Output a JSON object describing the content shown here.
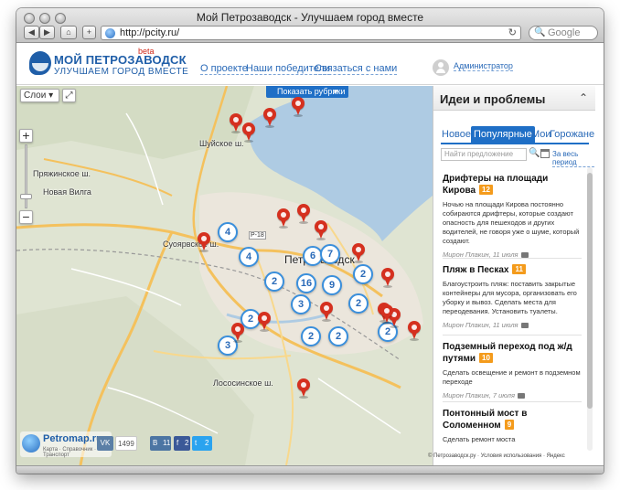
{
  "browser": {
    "window_title": "Мой Петрозаводск - Улучшаем город вместе",
    "url": "http://pcity.ru/",
    "search_placeholder": "Google"
  },
  "site": {
    "logo_title": "МОЙ ПЕТРОЗАВОДСК",
    "logo_beta": "beta",
    "logo_subtitle": "УЛУЧШАЕМ ГОРОД ВМЕСТЕ",
    "nav": [
      "О проекте",
      "Наши победители",
      "Связаться с нами"
    ],
    "user_link": "Администратор"
  },
  "map": {
    "layers_label": "Слои",
    "rubrics_button": "Показать рубрики",
    "city_label": "Петрозаводск",
    "labels": [
      "Новая Вилга",
      "Пряжинское ш.",
      "Суоярвское ш.",
      "Лососинское ш.",
      "Шуйское ш.",
      "Р-18"
    ],
    "clusters": [
      "4",
      "4",
      "6",
      "7",
      "2",
      "2",
      "16",
      "9",
      "3",
      "2",
      "2",
      "2",
      "2",
      "2",
      "3"
    ],
    "pin_count": 18
  },
  "bottom": {
    "petromap_name": "Petromap.ru",
    "petromap_sub": "Карта · Справочник · Транспорт",
    "vk_count": "1499",
    "vk_label": "В",
    "b_count": "11",
    "fb_count": "2",
    "tw_count": "2",
    "map_footer": "© Петрозаводск.ру · Условия использования · Яндекс"
  },
  "sidebar": {
    "title": "Идеи и проблемы",
    "tabs": [
      "Новое",
      "Популярные",
      "Мои",
      "Горожане"
    ],
    "active_tab": "Популярные",
    "search_placeholder": "Найти предложение",
    "period_link": "За весь период",
    "items": [
      {
        "title": "Дрифтеры на площади Кирова",
        "rating": "12",
        "desc": "Ночью на площади Кирова постоянно собираются дрифтеры, которые создают опасность для пешеходов и других водителей, не говоря уже о шуме, который создают.",
        "meta": "Мирон Плакин, 11 июля"
      },
      {
        "title": "Пляж в Песках",
        "rating": "11",
        "desc": "Благоустроить пляж: поставить закрытые контейнеры для мусора, организовать его уборку и вывоз. Сделать места для переодевания. Установить туалеты.",
        "meta": "Мирон Плакин, 11 июля"
      },
      {
        "title": "Подземный переход под ж/д путями",
        "rating": "10",
        "desc": "Сделать освещение и ремонт в подземном переходе",
        "meta": "Мирон Плакин, 7 июля"
      },
      {
        "title": "Понтонный мост в Соломенном",
        "rating": "9",
        "desc": "Сделать ремонт моста",
        "meta": ""
      }
    ]
  },
  "colors": {
    "brand_blue": "#1f5ea8",
    "tab_active": "#1f6fc6",
    "pin_red": "#d5301f",
    "rating_orange": "#f49b1c",
    "water": "#aecbe3"
  }
}
